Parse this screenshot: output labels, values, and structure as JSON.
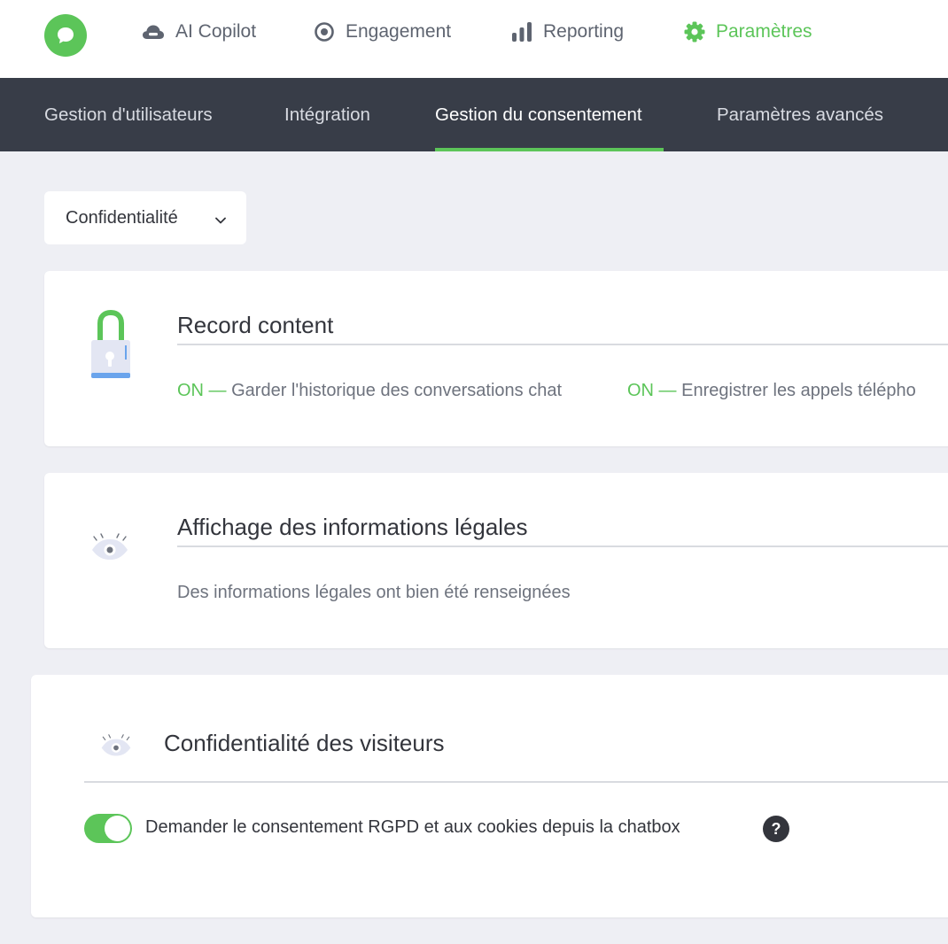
{
  "topnav": {
    "items": [
      {
        "label": "AI Copilot",
        "icon": "cloud-icon"
      },
      {
        "label": "Engagement",
        "icon": "target-icon"
      },
      {
        "label": "Reporting",
        "icon": "bar-chart-icon"
      },
      {
        "label": "Paramètres",
        "icon": "gear-icon",
        "active": true
      }
    ]
  },
  "subnav": {
    "tabs": [
      {
        "label": "Gestion d'utilisateurs"
      },
      {
        "label": "Intégration"
      },
      {
        "label": "Gestion du consentement",
        "active": true
      },
      {
        "label": "Paramètres avancés"
      }
    ]
  },
  "dropdown": {
    "selected": "Confidentialité"
  },
  "record_card": {
    "title": "Record content",
    "items": [
      {
        "status": "ON —",
        "text": "Garder l'historique des conversations chat"
      },
      {
        "status": "ON —",
        "text": "Enregistrer les appels télépho"
      }
    ]
  },
  "legal_card": {
    "title": "Affichage des informations légales",
    "text": "Des informations légales ont bien été renseignées"
  },
  "privacy_card": {
    "title": "Confidentialité des visiteurs",
    "toggle_label": "Demander le consentement RGPD et aux cookies depuis la chatbox",
    "toggle_on": true,
    "help": "?"
  },
  "colors": {
    "accent": "#5cc559",
    "subnav_bg": "#383d48",
    "page_bg": "#eeeff4"
  }
}
